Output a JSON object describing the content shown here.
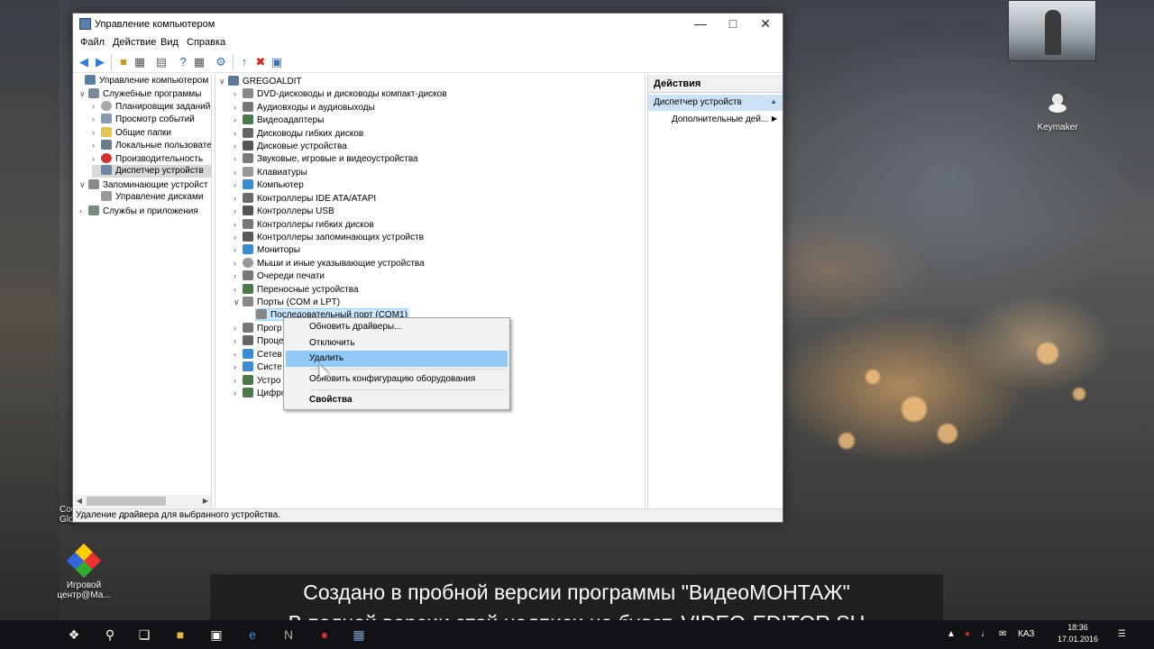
{
  "window": {
    "title": "Управление компьютером",
    "menu": [
      "Файл",
      "Действие",
      "Вид",
      "Справка"
    ],
    "status": "Удаление драйвера для выбранного устройства."
  },
  "left_tree": [
    "Управление компьютером (л",
    "Служебные программы",
    "Планировщик заданий",
    "Просмотр событий",
    "Общие папки",
    "Локальные пользовате",
    "Производительность",
    "Диспетчер устройств",
    "Запоминающие устройст",
    "Управление дисками",
    "Службы и приложения"
  ],
  "device_tree": {
    "root": "GREGOALDIT",
    "items": [
      "DVD-дисководы и дисководы компакт-дисков",
      "Аудиовходы и аудиовыходы",
      "Видеоадаптеры",
      "Дисководы гибких дисков",
      "Дисковые устройства",
      "Звуковые, игровые и видеоустройства",
      "Клавиатуры",
      "Компьютер",
      "Контроллеры IDE ATA/ATAPI",
      "Контроллеры USB",
      "Контроллеры гибких дисков",
      "Контроллеры запоминающих устройств",
      "Мониторы",
      "Мыши и иные указывающие устройства",
      "Очереди печати",
      "Переносные устройства",
      "Порты (COM и LPT)"
    ],
    "selected_child": "Последовательный порт (COM1)",
    "partial_items": [
      "Прогр",
      "Проце",
      "Сетев",
      "Систе",
      "Устро",
      "Цифро"
    ]
  },
  "context_menu": {
    "items": [
      "Обновить драйверы...",
      "Отключить",
      "Удалить",
      "Обновить конфигурацию оборудования",
      "Свойства"
    ]
  },
  "actions": {
    "header": "Действия",
    "selected": "Диспетчер устройств",
    "more": "Дополнительные дей..."
  },
  "desktop": {
    "icons": [
      {
        "label": "Keymaker"
      },
      {
        "label": "Игровой центр@Ma..."
      }
    ],
    "left_fragments": [
      "Cou",
      "Glob"
    ]
  },
  "watermark": {
    "line1": "Создано в пробной версии программы \"ВидеоМОНТАЖ\"",
    "line2": "В полной версии этой надписи не будет. VIDEO-EDITOR.SU"
  },
  "taskbar": {
    "lang": "КАЗ",
    "time": "18:36",
    "date": "17.01.2016"
  },
  "colors": {
    "selection_highlight": "#91c9f7",
    "actions_selected": "#cde2f5",
    "taskbar": "#101216"
  }
}
